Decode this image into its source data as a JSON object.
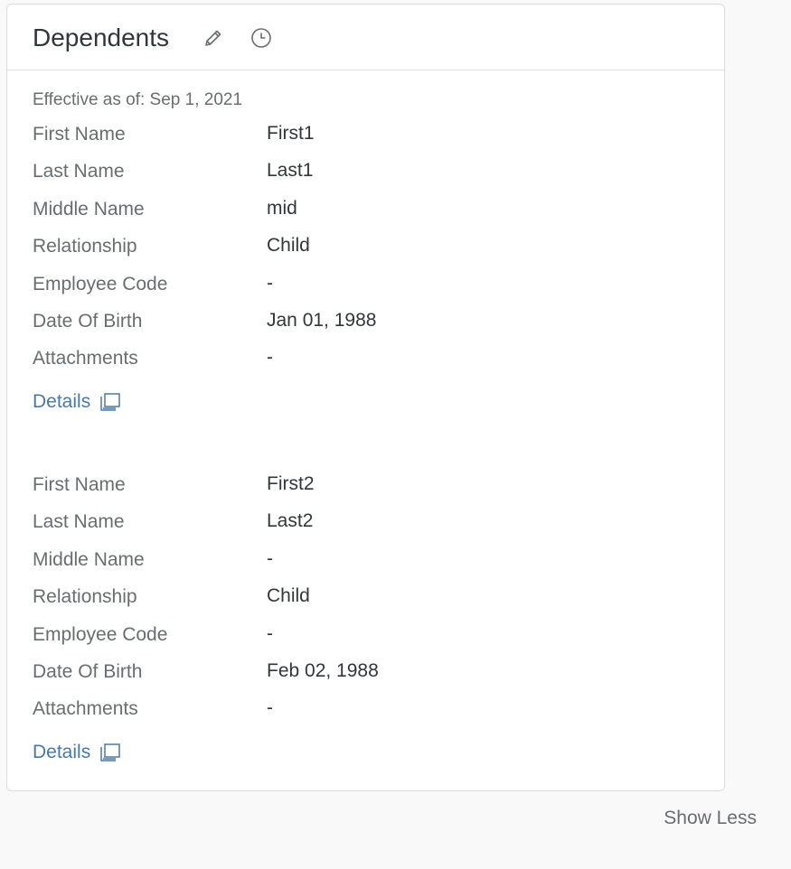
{
  "card": {
    "title": "Dependents",
    "effective_label": "Effective as of: Sep 1, 2021"
  },
  "icons": {
    "edit": "pencil-icon",
    "history": "clock-icon",
    "details": "open-dialog-icon"
  },
  "dependents": [
    {
      "rows": [
        {
          "label": "First Name",
          "value": "First1"
        },
        {
          "label": "Last Name",
          "value": "Last1"
        },
        {
          "label": "Middle Name",
          "value": "mid"
        },
        {
          "label": "Relationship",
          "value": "Child"
        },
        {
          "label": "Employee Code",
          "value": "-"
        },
        {
          "label": "Date Of Birth",
          "value": "Jan 01, 1988"
        },
        {
          "label": "Attachments",
          "value": "-"
        }
      ],
      "details_label": "Details"
    },
    {
      "rows": [
        {
          "label": "First Name",
          "value": "First2"
        },
        {
          "label": "Last Name",
          "value": "Last2"
        },
        {
          "label": "Middle Name",
          "value": "-"
        },
        {
          "label": "Relationship",
          "value": "Child"
        },
        {
          "label": "Employee Code",
          "value": "-"
        },
        {
          "label": "Date Of Birth",
          "value": "Feb 02, 1988"
        },
        {
          "label": "Attachments",
          "value": "-"
        }
      ],
      "details_label": "Details"
    }
  ],
  "footer": {
    "show_less_label": "Show Less"
  },
  "colors": {
    "link": "#4a78a8",
    "label": "#6a6d70",
    "value": "#32363a"
  }
}
